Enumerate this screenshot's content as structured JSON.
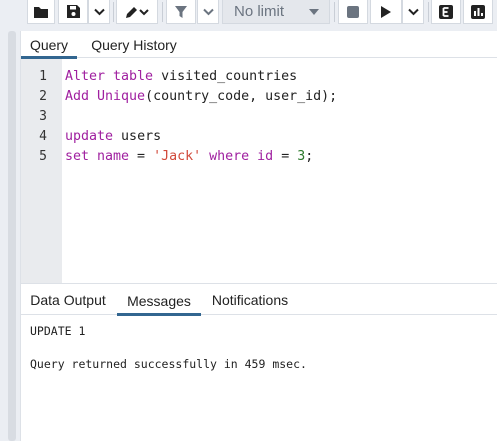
{
  "toolbar": {
    "icons": [
      "folder-icon",
      "save-icon",
      "chevron-down-icon",
      "pencil-icon",
      "filter-icon",
      "stop-icon",
      "play-icon",
      "explain-icon",
      "chart-icon"
    ],
    "limit_value": "No limit"
  },
  "editor_tabs": [
    "Query",
    "Query History"
  ],
  "code": {
    "line_numbers": [
      "1",
      "2",
      "3",
      "4",
      "5"
    ],
    "lines": [
      [
        {
          "t": "Alter table",
          "c": "kw"
        },
        {
          "t": " visited_countries",
          "c": "op"
        }
      ],
      [
        {
          "t": "Add Unique",
          "c": "kw"
        },
        {
          "t": "(country_code, user_id);",
          "c": "op"
        }
      ],
      [],
      [
        {
          "t": "update",
          "c": "kw"
        },
        {
          "t": " users",
          "c": "op"
        }
      ],
      [
        {
          "t": "set name",
          "c": "kw"
        },
        {
          "t": " = ",
          "c": "op"
        },
        {
          "t": "'Jack'",
          "c": "str"
        },
        {
          "t": " ",
          "c": "op"
        },
        {
          "t": "where id",
          "c": "kw"
        },
        {
          "t": " = ",
          "c": "op"
        },
        {
          "t": "3",
          "c": "num"
        },
        {
          "t": ";",
          "c": "op"
        }
      ]
    ]
  },
  "output_tabs": [
    "Data Output",
    "Messages",
    "Notifications"
  ],
  "output": {
    "line1": "UPDATE 1",
    "line2": "Query returned successfully in 459 msec."
  },
  "colors": {
    "keyword": "#a020a0",
    "string": "#d1493a",
    "number": "#2d7a2d",
    "accent": "#326690"
  }
}
